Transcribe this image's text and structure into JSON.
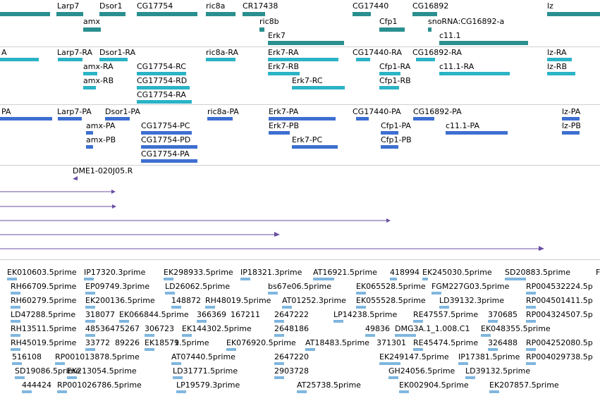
{
  "colors": {
    "gene": "#2a8f8f",
    "transcript_light": "#2bb3c6",
    "transcript_dark": "#3e6fd1",
    "alignment": "#6a4fa3",
    "est": "#7fb6df",
    "separator": "#cfcfcf"
  },
  "tracks": {
    "genes": [
      "Larp7",
      "Dsor1",
      "CG17754",
      "ric8a",
      "CR17438",
      "CG17440",
      "CG16892",
      "lz",
      "amx",
      "ric8b",
      "Cfp1",
      "snoRNA:CG16892-a",
      "Erk7",
      "c11.1"
    ],
    "transcripts_ra": [
      "A",
      "Larp7-RA",
      "Dsor1-RA",
      "ric8a-RA",
      "Erk7-RA",
      "CG17440-RA",
      "CG16892-RA",
      "lz-RA",
      "amx-RA",
      "CG17754-RC",
      "Erk7-RB",
      "Cfp1-RA",
      "c11.1-RA",
      "lz-RB",
      "amx-RB",
      "CG17754-RD",
      "Erk7-RC",
      "Cfp1-RB",
      "CG17754-RA"
    ],
    "transcripts_pa": [
      "PA",
      "Larp7-PA",
      "Dsor1-PA",
      "ric8a-PA",
      "Erk7-PA",
      "CG17440-PA",
      "CG16892-PA",
      "lz-PA",
      "amx-PA",
      "CG17754-PC",
      "Erk7-PB",
      "Cfp1-PA",
      "c11.1-PA",
      "lz-PB",
      "amx-PB",
      "CG17754-PD",
      "Erk7-PC",
      "Cfp1-PB",
      "CG17754-PA"
    ],
    "clone": "DME1-020J05.R",
    "est_labels": [
      "EK010603.5prime",
      "IP17320.3prime",
      "EK298933.5prime",
      "IP18321.3prime",
      "AT16921.5prime",
      "418994",
      "EK245030.5prime",
      "SD20883.5prime",
      "F",
      "RH66709.5prime",
      "EP09749.3prime",
      "LD26062.5prime",
      "bs67e06.5prime",
      "EK065528.5prime",
      "FGM227G03.5prime",
      "RP004532224.5p",
      "RH60279.5prime",
      "EK200136.5prime",
      "148872",
      "RH48019.5prime",
      "AT01252.3prime",
      "EK055528.5prime",
      "LD39132.3prime",
      "RP004501411.5p",
      "LD47288.5prime",
      "318077",
      "EK066844.5prime",
      "366369",
      "167211",
      "2647222",
      "LP14238.5prime",
      "RE47557.5prime",
      "370685",
      "RP004324507.5p",
      "RH13511.5prime",
      "485364",
      "75267",
      "306723",
      "EK144302.5prime",
      "2648186",
      "49836",
      "DMG3A.1_1.008.C1",
      "EK048355.5prime",
      "RH45019.5prime",
      "33772",
      "89226",
      "EK18571",
      "9.5prime",
      "EK076920.5prime",
      "AT18483.5prime",
      "371301",
      "RE45474.5prime",
      "326488",
      "RP004252080.5p",
      "516108",
      "RP001013878.5prime",
      "AT07440.5prime",
      "2647220",
      "EK249147.5prime",
      "IP17381.5prime",
      "RP004029738.5p",
      "SD19086.5prime",
      "EK213054.5prime",
      "LD31771.5prime",
      "2903728",
      "GH24056.5prime",
      "LD39132.5prime",
      "444424",
      "RP001026786.5prime",
      "LP19579.3prime",
      "AT25738.5prime",
      "EK002904.5prime",
      "EK207857.5prime"
    ]
  }
}
